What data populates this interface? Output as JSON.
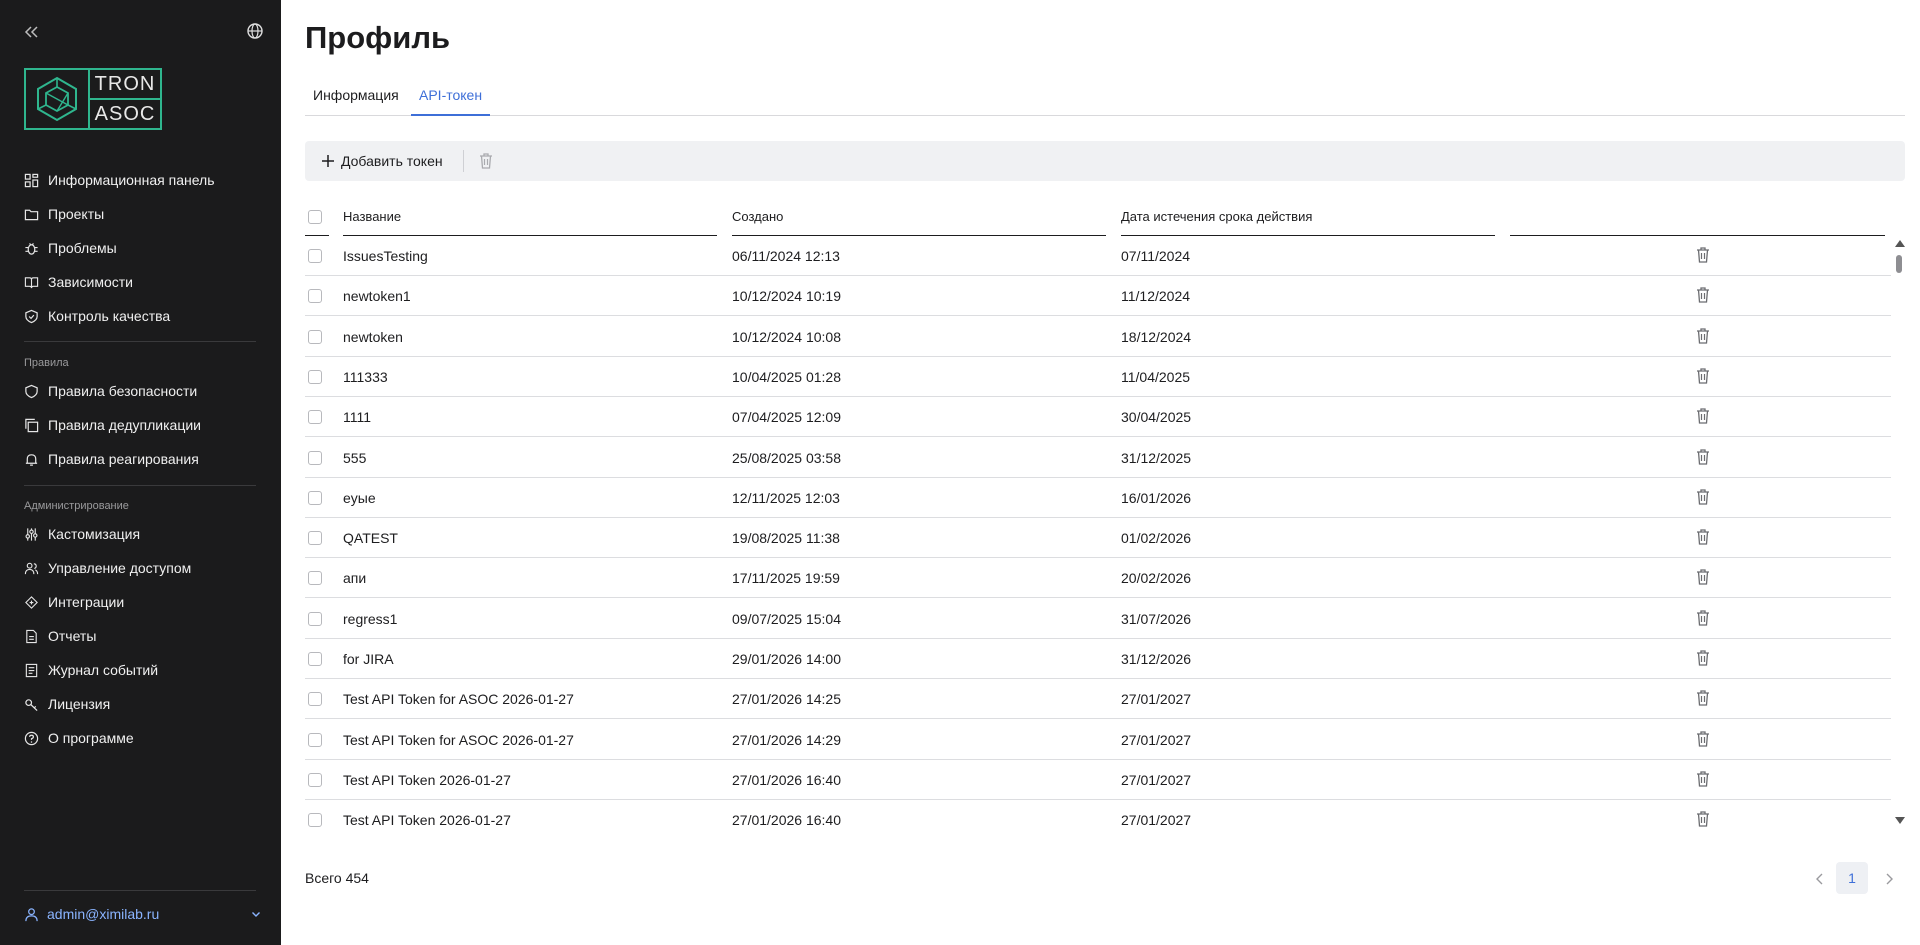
{
  "logo": {
    "top_text": "TRON",
    "bottom_text": "ASOC"
  },
  "sidebar": {
    "main_items": [
      {
        "label": "Информационная панель",
        "icon": "dashboard-icon"
      },
      {
        "label": "Проекты",
        "icon": "folder-icon"
      },
      {
        "label": "Проблемы",
        "icon": "bug-icon"
      },
      {
        "label": "Зависимости",
        "icon": "book-icon"
      },
      {
        "label": "Контроль качества",
        "icon": "shield-check-icon"
      }
    ],
    "rules_section": "Правила",
    "rules_items": [
      {
        "label": "Правила безопасности",
        "icon": "shield-icon"
      },
      {
        "label": "Правила дедупликации",
        "icon": "copy-icon"
      },
      {
        "label": "Правила реагирования",
        "icon": "bell-icon"
      }
    ],
    "admin_section": "Администрирование",
    "admin_items": [
      {
        "label": "Кастомизация",
        "icon": "sliders-icon"
      },
      {
        "label": "Управление доступом",
        "icon": "users-icon"
      },
      {
        "label": "Интеграции",
        "icon": "integration-icon"
      },
      {
        "label": "Отчеты",
        "icon": "report-icon"
      },
      {
        "label": "Журнал событий",
        "icon": "log-icon"
      },
      {
        "label": "Лицензия",
        "icon": "key-icon"
      },
      {
        "label": "О программе",
        "icon": "help-icon"
      }
    ],
    "user_email": "admin@ximilab.ru"
  },
  "page": {
    "title": "Профиль",
    "tabs": [
      "Информация",
      "API-токен"
    ],
    "active_tab": "API-токен"
  },
  "toolbar": {
    "add_label": "Добавить токен"
  },
  "table": {
    "columns": [
      "Название",
      "Создано",
      "Дата истечения срока действия",
      ""
    ],
    "rows": [
      {
        "name": "IssuesTesting",
        "created": "06/11/2024 12:13",
        "expires": "07/11/2024"
      },
      {
        "name": "newtoken1",
        "created": "10/12/2024 10:19",
        "expires": "11/12/2024"
      },
      {
        "name": "newtoken",
        "created": "10/12/2024 10:08",
        "expires": "18/12/2024"
      },
      {
        "name": "111333",
        "created": "10/04/2025 01:28",
        "expires": "11/04/2025"
      },
      {
        "name": "1111",
        "created": "07/04/2025 12:09",
        "expires": "30/04/2025"
      },
      {
        "name": "555",
        "created": "25/08/2025 03:58",
        "expires": "31/12/2025"
      },
      {
        "name": "eyыe",
        "created": "12/11/2025 12:03",
        "expires": "16/01/2026"
      },
      {
        "name": "QATEST",
        "created": "19/08/2025 11:38",
        "expires": "01/02/2026"
      },
      {
        "name": "апи",
        "created": "17/11/2025 19:59",
        "expires": "20/02/2026"
      },
      {
        "name": "regress1",
        "created": "09/07/2025 15:04",
        "expires": "31/07/2026"
      },
      {
        "name": "for JIRA",
        "created": "29/01/2026 14:00",
        "expires": "31/12/2026"
      },
      {
        "name": "Test API Token for ASOC 2026-01-27",
        "created": "27/01/2026 14:25",
        "expires": "27/01/2027"
      },
      {
        "name": "Test API Token for ASOC 2026-01-27",
        "created": "27/01/2026 14:29",
        "expires": "27/01/2027"
      },
      {
        "name": "Test API Token 2026-01-27",
        "created": "27/01/2026 16:40",
        "expires": "27/01/2027"
      },
      {
        "name": "Test API Token 2026-01-27",
        "created": "27/01/2026 16:40",
        "expires": "27/01/2027"
      }
    ]
  },
  "footer": {
    "total": "Всего 454",
    "current_page": "1"
  },
  "colors": {
    "accent": "#3e6fd8",
    "logo_green": "#2fb68e",
    "sidebar_bg": "#1b1b1c",
    "user_email": "#8ab4ff"
  }
}
